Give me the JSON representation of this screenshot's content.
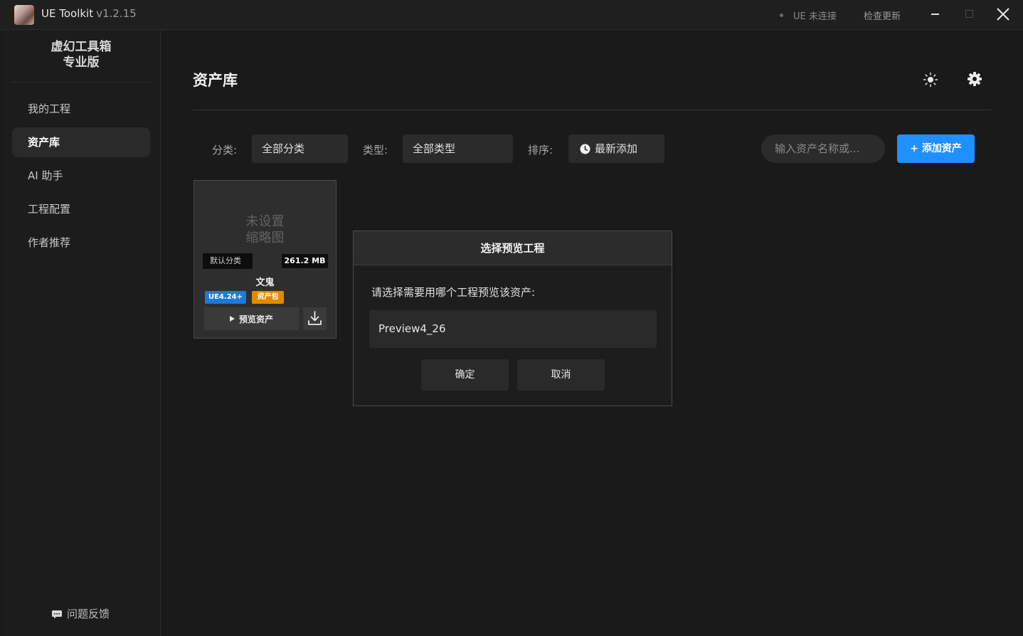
{
  "titlebar": {
    "app_name": "UE Toolkit",
    "version": "v1.2.15",
    "ue_status": "UE 未连接",
    "check_update": "检查更新"
  },
  "sidebar": {
    "brand_line1": "虚幻工具箱",
    "brand_line2": "专业版",
    "items": [
      {
        "label": "我的工程"
      },
      {
        "label": "资产库"
      },
      {
        "label": "AI 助手"
      },
      {
        "label": "工程配置"
      },
      {
        "label": "作者推荐"
      }
    ],
    "active_index": 1,
    "feedback": "问题反馈"
  },
  "main": {
    "title": "资产库",
    "filters": {
      "category_label": "分类:",
      "category_value": "全部分类",
      "type_label": "类型:",
      "type_value": "全部类型",
      "sort_label": "排序:",
      "sort_value": "最新添加"
    },
    "search": {
      "placeholder": "输入资产名称或..."
    },
    "add_button": "+ 添加资产"
  },
  "asset_card": {
    "thumb_line1": "未设置",
    "thumb_line2": "缩略图",
    "category": "默认分类",
    "size": "261.2 MB",
    "name": "文鬼",
    "version_tag": "UE4.24+",
    "type_tag": "资产包",
    "preview_label": "预览资产"
  },
  "dialog": {
    "title": "选择预览工程",
    "prompt": "请选择需要用哪个工程预览该资产:",
    "option": "Preview4_26",
    "confirm": "确定",
    "cancel": "取消"
  },
  "colors": {
    "accent": "#1e90ff",
    "tag_version": "#1c7ad8",
    "tag_type": "#e08a00",
    "background": "#1a1a1a"
  }
}
